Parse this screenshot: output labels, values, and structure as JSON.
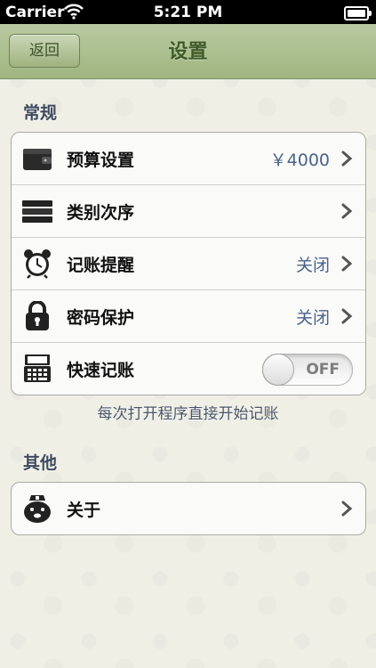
{
  "statusbar": {
    "carrier": "Carrier",
    "time": "5:21 PM",
    "battery_level": 1.0
  },
  "navbar": {
    "back_label": "返回",
    "title": "设置"
  },
  "general": {
    "header": "常规",
    "rows": [
      {
        "label": "预算设置",
        "value": "￥4000",
        "icon": "wallet-icon"
      },
      {
        "label": "类别次序",
        "value": "",
        "icon": "stack-icon"
      },
      {
        "label": "记账提醒",
        "value": "关闭",
        "icon": "alarm-clock-icon"
      },
      {
        "label": "密码保护",
        "value": "关闭",
        "icon": "padlock-icon"
      },
      {
        "label": "快速记账",
        "icon": "cash-register-icon",
        "toggle": "OFF",
        "toggle_on": false
      }
    ],
    "footnote": "每次打开程序直接开始记账"
  },
  "other": {
    "header": "其他",
    "rows": [
      {
        "label": "关于",
        "icon": "mascot-icon"
      }
    ]
  },
  "colors": {
    "nav_green": "#9fb580",
    "value_blue": "#4a6389"
  }
}
